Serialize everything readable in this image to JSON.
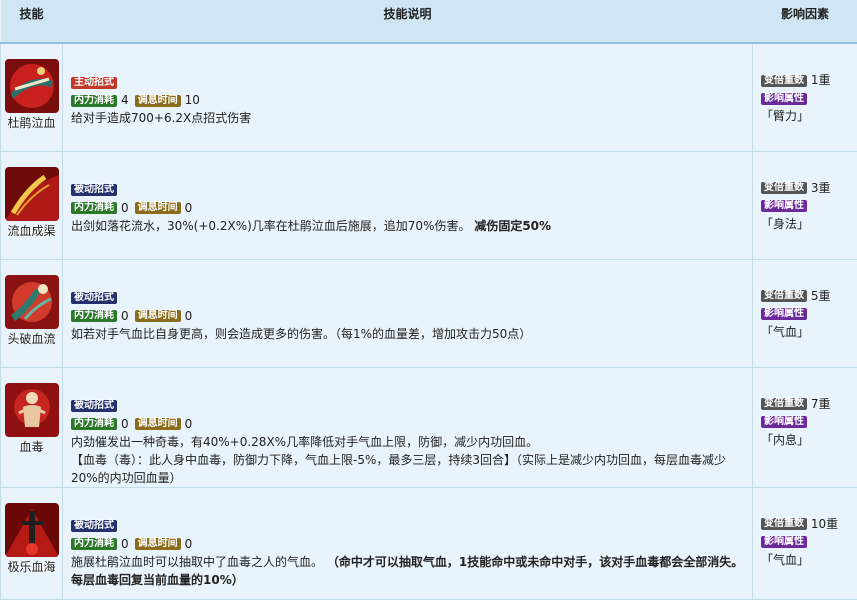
{
  "header": {
    "col_skill": "技能",
    "col_desc": "技能说明",
    "col_factors": "影响因素"
  },
  "labels": {
    "neili": "内力消耗",
    "cooldown": "调息时间",
    "multiplier": "变倍重数",
    "attribute": "影响属性"
  },
  "skills": [
    {
      "name": "杜鹃泣血",
      "type": "主动招式",
      "neili": "4",
      "cooldown": "10",
      "desc": "给对手造成700+6.2X点招式伤害",
      "desc_bold": "",
      "multiplier": "1重",
      "attribute": "「臂力」"
    },
    {
      "name": "流血成渠",
      "type": "被动招式",
      "neili": "0",
      "cooldown": "0",
      "desc": "出剑如落花流水，30%(+0.2X%)几率在杜鹃泣血后施展，追加70%伤害。",
      "desc_bold": "减伤固定50%",
      "multiplier": "3重",
      "attribute": "「身法」"
    },
    {
      "name": "头破血流",
      "type": "被动招式",
      "neili": "0",
      "cooldown": "0",
      "desc": "如若对手气血比自身更高，则会造成更多的伤害。（每1%的血量差，增加攻击力50点）",
      "desc_bold": "",
      "multiplier": "5重",
      "attribute": "「气血」"
    },
    {
      "name": "血毒",
      "type": "被动招式",
      "neili": "0",
      "cooldown": "0",
      "desc": "内劲催发出一种奇毒，有40%+0.28X%几率降低对手气血上限，防御，减少内功回血。",
      "desc2": "【血毒（毒）：此人身中血毒，防御力下降，气血上限-5%，最多三层，持续3回合】（实际上是减少内功回血，每层血毒减少20%的内功回血量）",
      "desc_bold": "",
      "multiplier": "7重",
      "attribute": "「内息」"
    },
    {
      "name": "极乐血海",
      "type": "被动招式",
      "neili": "0",
      "cooldown": "0",
      "desc": "施展杜鹃泣血时可以抽取中了血毒之人的气血。",
      "desc_bold": "（命中才可以抽取气血，1技能命中或未命中对手，该对手血毒都会全部消失。每层血毒回复当前血量的10%）",
      "multiplier": "10重",
      "attribute": "「气血」"
    }
  ],
  "colors": {
    "header_bg": "#cfe6f5",
    "row_bg": "#e8f3fb",
    "tag_active": "#c0392b",
    "tag_passive": "#22306e",
    "tag_neili": "#2a7a2a",
    "tag_cooldown": "#8a6d1a",
    "tag_multiplier": "#555555",
    "tag_attribute": "#6b2a9a"
  }
}
